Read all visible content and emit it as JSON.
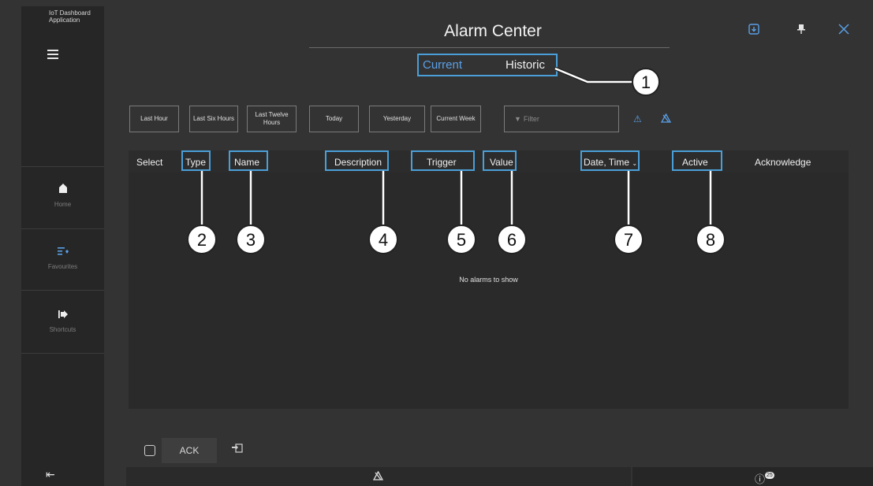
{
  "app": {
    "title": "IoT Dashboard Application"
  },
  "sidebar": {
    "items": [
      {
        "label": "Home",
        "icon": "home-icon"
      },
      {
        "label": "Favourites",
        "icon": "favourites-list-icon"
      },
      {
        "label": "Shortcuts",
        "icon": "shortcuts-icon"
      }
    ]
  },
  "header": {
    "title": "Alarm Center"
  },
  "tabs": {
    "current": "Current",
    "historic": "Historic"
  },
  "time_filters": [
    "Last Hour",
    "Last Six Hours",
    "Last Twelve Hours",
    "Today",
    "Yesterday",
    "Current Week"
  ],
  "filter": {
    "placeholder": "Filter"
  },
  "table": {
    "columns": [
      "Select",
      "Type",
      "Name",
      "Description",
      "Trigger",
      "Value",
      "Date, Time",
      "Active",
      "Acknowledge"
    ],
    "empty_message": "No alarms to show"
  },
  "callouts": [
    "1",
    "2",
    "3",
    "4",
    "5",
    "6",
    "7",
    "8"
  ],
  "footer": {
    "ack_label": "ACK",
    "info_badge": "25"
  },
  "colors": {
    "accent": "#4a9fd8",
    "background": "#333333",
    "sidebar": "#262626"
  }
}
